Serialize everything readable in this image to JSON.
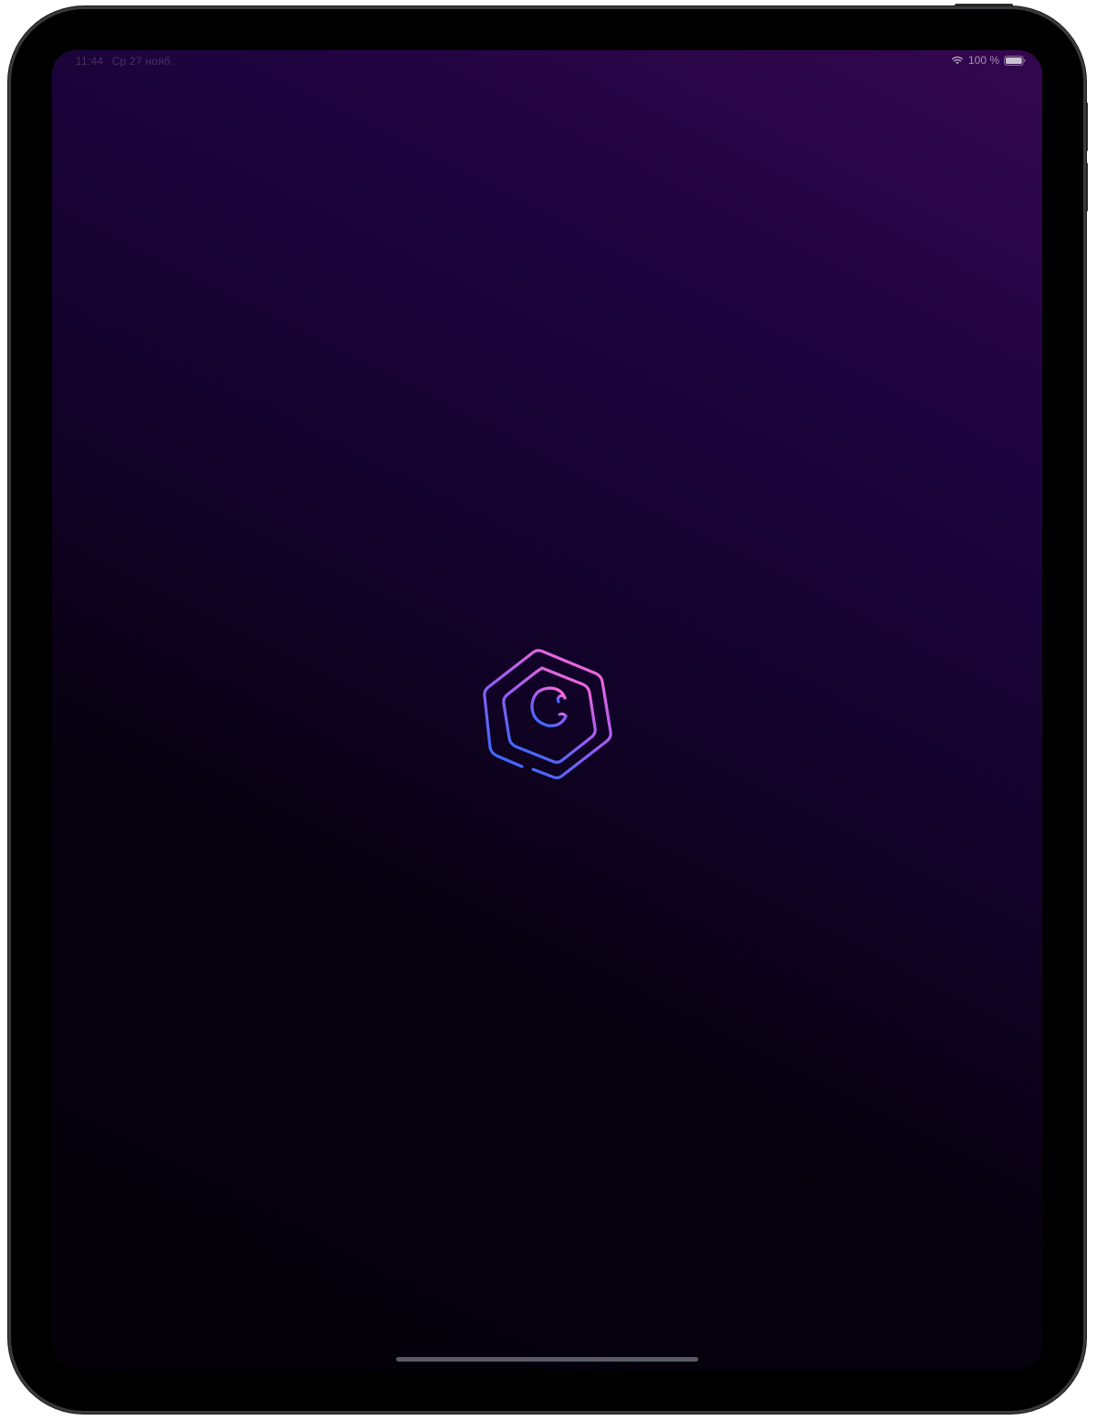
{
  "status_bar": {
    "time": "11:44",
    "date": "Ср 27 нояб.",
    "battery_percent_label": "100 %",
    "wifi_icon": "wifi-icon",
    "battery_icon": "battery-icon",
    "battery_level": 1.0
  },
  "splash": {
    "logo_icon": "hexagon-c-logo-icon",
    "logo_gradient": [
      "#ff6ad5",
      "#9b5cf6",
      "#2f6bff"
    ]
  },
  "colors": {
    "background_top": "#34074f",
    "background_bottom": "#040109",
    "home_indicator": "#5a5a66"
  }
}
